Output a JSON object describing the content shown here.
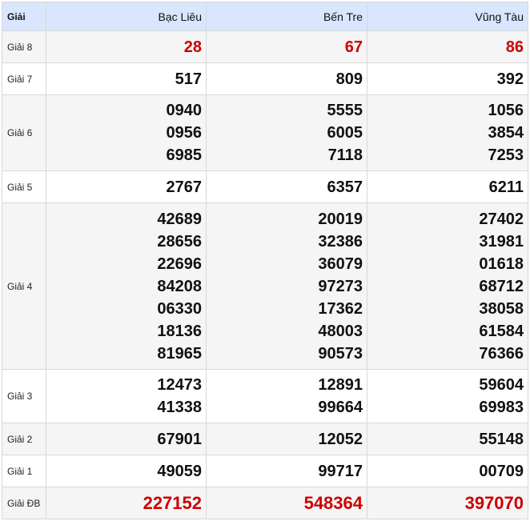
{
  "header": {
    "label": "Giải",
    "provinces": [
      "Bạc Liêu",
      "Bến Tre",
      "Vũng Tàu"
    ]
  },
  "prizes": [
    {
      "label": "Giải 8",
      "values": [
        [
          "28"
        ],
        [
          "67"
        ],
        [
          "86"
        ]
      ],
      "highlight": true
    },
    {
      "label": "Giải 7",
      "values": [
        [
          "517"
        ],
        [
          "809"
        ],
        [
          "392"
        ]
      ]
    },
    {
      "label": "Giải 6",
      "values": [
        [
          "0940",
          "0956",
          "6985"
        ],
        [
          "5555",
          "6005",
          "7118"
        ],
        [
          "1056",
          "3854",
          "7253"
        ]
      ]
    },
    {
      "label": "Giải 5",
      "values": [
        [
          "2767"
        ],
        [
          "6357"
        ],
        [
          "6211"
        ]
      ]
    },
    {
      "label": "Giải 4",
      "values": [
        [
          "42689",
          "28656",
          "22696",
          "84208",
          "06330",
          "18136",
          "81965"
        ],
        [
          "20019",
          "32386",
          "36079",
          "97273",
          "17362",
          "48003",
          "90573"
        ],
        [
          "27402",
          "31981",
          "01618",
          "68712",
          "38058",
          "61584",
          "76366"
        ]
      ]
    },
    {
      "label": "Giải 3",
      "values": [
        [
          "12473",
          "41338"
        ],
        [
          "12891",
          "99664"
        ],
        [
          "59604",
          "69983"
        ]
      ]
    },
    {
      "label": "Giải 2",
      "values": [
        [
          "67901"
        ],
        [
          "12052"
        ],
        [
          "55148"
        ]
      ]
    },
    {
      "label": "Giải 1",
      "values": [
        [
          "49059"
        ],
        [
          "99717"
        ],
        [
          "00709"
        ]
      ]
    },
    {
      "label": "Giải ĐB",
      "values": [
        [
          "227152"
        ],
        [
          "548364"
        ],
        [
          "397070"
        ]
      ],
      "highlight": true
    }
  ],
  "colors": {
    "header_bg": "#d9e6fd",
    "highlight": "#cc0000",
    "stripe": "#f5f5f5"
  }
}
